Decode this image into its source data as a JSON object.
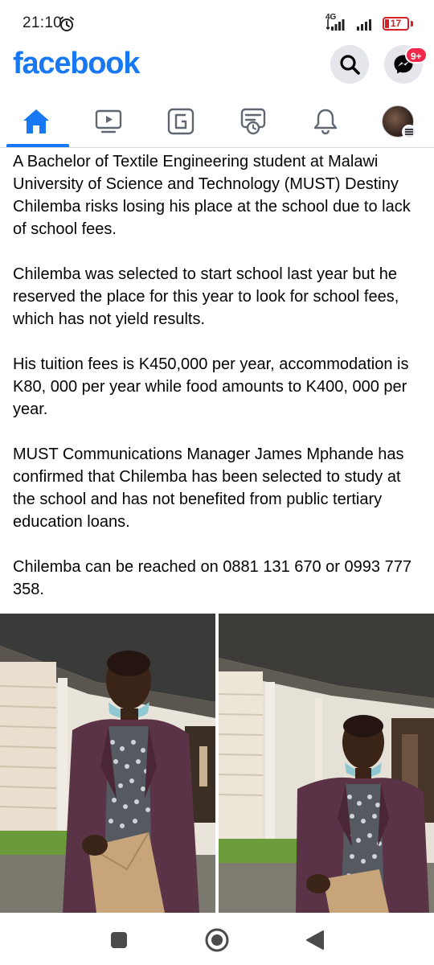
{
  "status_bar": {
    "time": "21:10",
    "network": "4G",
    "battery": "17",
    "battery_level": 0.17,
    "battery_color": "#d32027",
    "icons": [
      "alarm-icon",
      "signal-icon",
      "signal-icon",
      "battery-icon"
    ]
  },
  "header": {
    "logo": "facebook",
    "brand_color": "#1877f2",
    "search_icon": "search-icon",
    "messenger_icon": "messenger-icon",
    "messenger_badge": "9+",
    "badge_color": "#f02849"
  },
  "tabs": [
    {
      "icon": "home-icon",
      "active": true
    },
    {
      "icon": "video-icon",
      "active": false
    },
    {
      "icon": "gaming-icon",
      "active": false
    },
    {
      "icon": "feeds-icon",
      "active": false
    },
    {
      "icon": "bell-icon",
      "active": false
    },
    {
      "icon": "profile-avatar-icon",
      "active": false
    }
  ],
  "post": {
    "paragraphs": [
      "A Bachelor of Textile Engineering student at Malawi University of Science and Technology (MUST) Destiny Chilemba risks losing his place at the school due to lack of school fees.",
      "Chilemba was selected to start school last year but he reserved the place for this year to look for school fees, which has not yield results.",
      "His tuition fees is K450,000 per year, accommodation is K80, 000 per year while food amounts to K400, 000 per year.",
      "MUST Communications Manager James Mphande has confirmed that Chilemba has been selected to study at the school and has not benefited from public tertiary education loans.",
      "Chilemba can be reached on 0881 131 670 or 0993 777 358."
    ],
    "photos": [
      "photo-1",
      "photo-2"
    ]
  },
  "nav_bar": {
    "icons": [
      "recents-square-icon",
      "home-circle-icon",
      "back-triangle-icon"
    ]
  }
}
